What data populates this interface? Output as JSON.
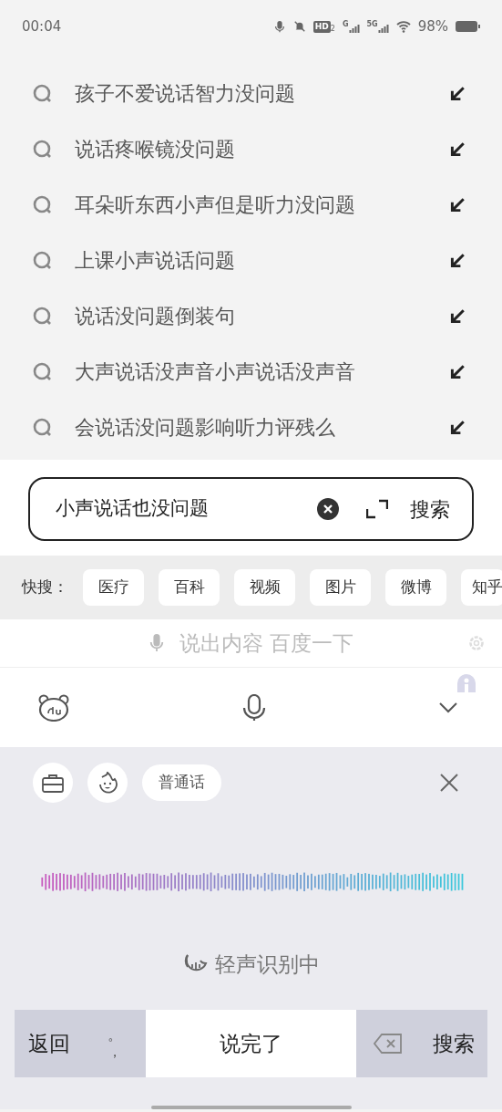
{
  "status_bar": {
    "time": "00:04",
    "hd_label": "HD",
    "hd_sub": "2",
    "networks": [
      "G",
      "5G"
    ],
    "battery": "98%"
  },
  "suggestions": [
    {
      "text": "孩子不爱说话智力没问题"
    },
    {
      "text": "说话疼喉镜没问题"
    },
    {
      "text": "耳朵听东西小声但是听力没问题"
    },
    {
      "text": "上课小声说话问题"
    },
    {
      "text": "说话没问题倒装句"
    },
    {
      "text": "大声说话没声音小声说话没声音"
    },
    {
      "text": "会说话没问题影响听力评残么"
    }
  ],
  "search": {
    "value": "小声说话也没问题",
    "button": "搜索"
  },
  "quick_search": {
    "label": "快搜：",
    "chips": [
      "医疗",
      "百科",
      "视频",
      "图片",
      "微博",
      "知乎"
    ]
  },
  "voice_hint": {
    "text": "说出内容 百度一下"
  },
  "voice_panel": {
    "language": "普通话",
    "status": "轻声识别中"
  },
  "keyboard": {
    "keys": [
      {
        "kind": "text",
        "label": "返回"
      },
      {
        "kind": "punct",
        "labels": [
          "。",
          "，"
        ]
      },
      {
        "kind": "primary",
        "label": "说完了"
      },
      {
        "kind": "backspace"
      },
      {
        "kind": "text",
        "label": "搜索"
      }
    ]
  }
}
